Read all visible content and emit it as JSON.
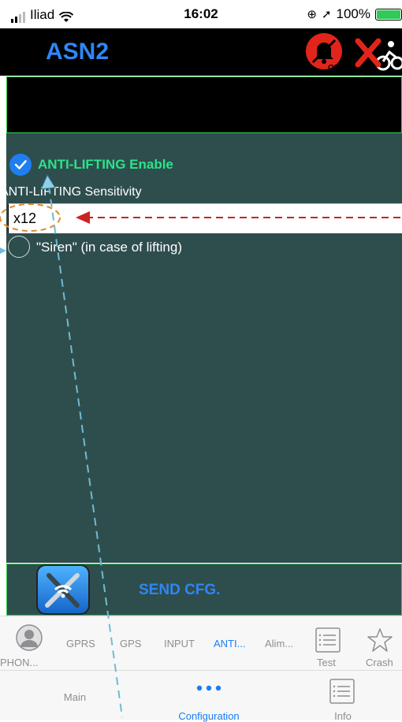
{
  "status_bar": {
    "carrier": "Iliad",
    "time": "16:02",
    "battery": "100%"
  },
  "header": {
    "title": "ASN2",
    "alarm_badge": "OFF"
  },
  "anti_lifting": {
    "enable_label": "ANTI-LIFTING Enable",
    "enable_checked": true,
    "sensitivity_label": "ANTI-LIFTING Sensitivity",
    "sensitivity_value": "x12",
    "siren_label": "\"Siren\" (in case of lifting)",
    "siren_checked": false
  },
  "send_button": {
    "label": "SEND CFG."
  },
  "top_tabs": [
    {
      "label": "PHON...",
      "icon": "person-icon"
    },
    {
      "label": "GPRS"
    },
    {
      "label": "GPS"
    },
    {
      "label": "INPUT"
    },
    {
      "label": "ANTI...",
      "active": true
    },
    {
      "label": "Alim..."
    },
    {
      "label": "Test",
      "icon": "list-icon"
    },
    {
      "label": "Crash",
      "icon": "star-icon"
    }
  ],
  "bottom_tabs": [
    {
      "label": "Main"
    },
    {
      "label": "Configuration",
      "icon": "more-icon",
      "active": true
    },
    {
      "label": "Info",
      "icon": "list-icon"
    }
  ],
  "colors": {
    "accent": "#2e86f5",
    "panel": "#2e4e4d",
    "border_green": "#2ed14f",
    "enable_green": "#2be38a",
    "alarm_red": "#e1251b"
  }
}
